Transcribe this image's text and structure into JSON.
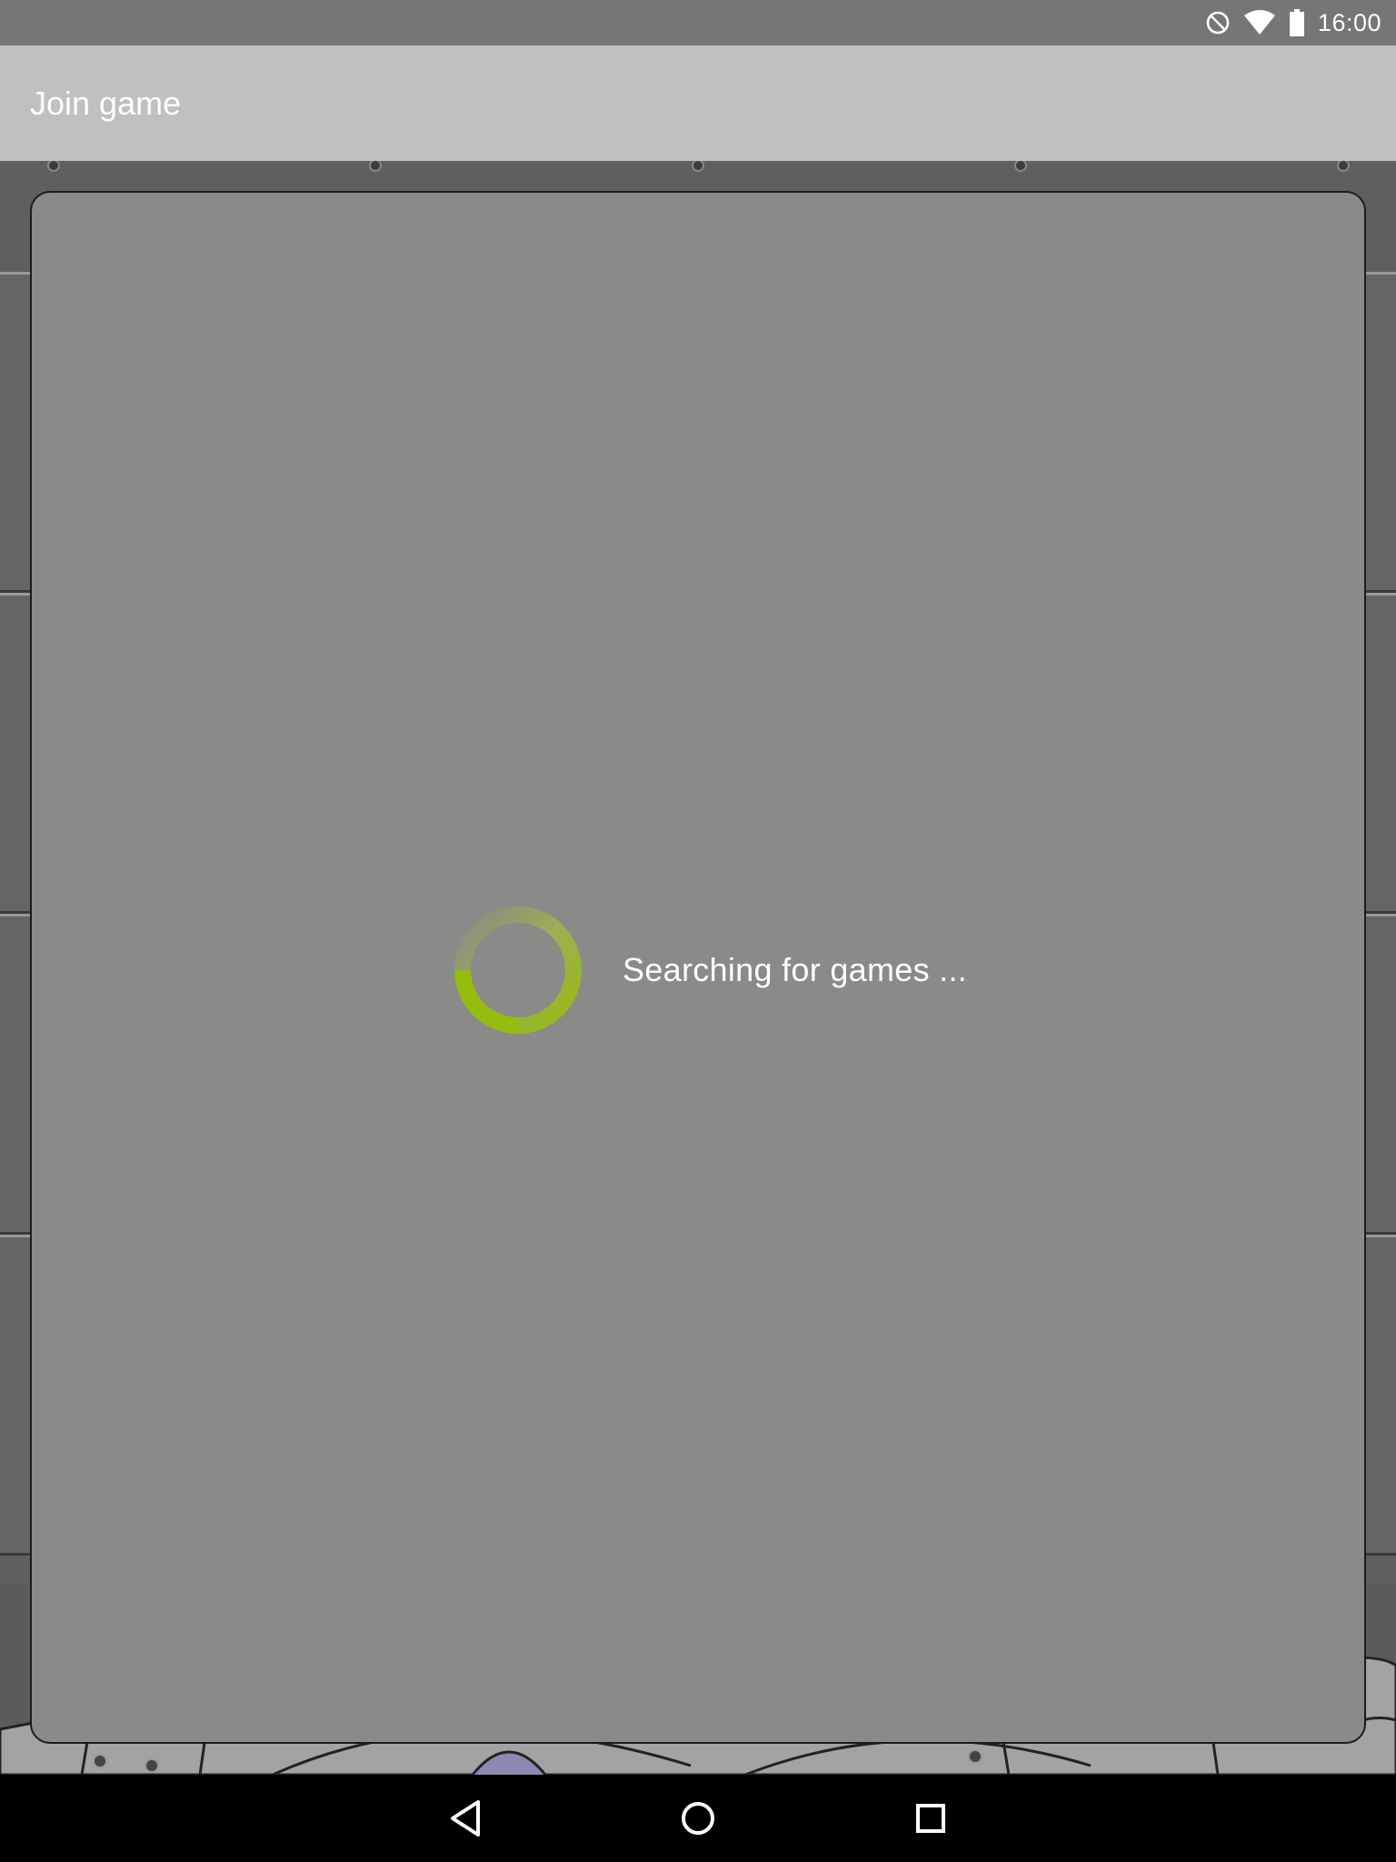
{
  "status_bar": {
    "time": "16:00",
    "icons": [
      "do-not-disturb-icon",
      "wifi-icon",
      "battery-icon"
    ]
  },
  "app_bar": {
    "title": "Join game"
  },
  "dialog": {
    "loading_text": "Searching for games ...",
    "spinner_color": "#8fb515"
  },
  "nav_bar": {
    "buttons": [
      "back-icon",
      "home-icon",
      "recents-icon"
    ]
  },
  "colors": {
    "status_bar_bg": "#767676",
    "app_bar_bg": "#c0c0c1",
    "dialog_bg": "#8a8a88",
    "nav_bar_bg": "#000000"
  }
}
